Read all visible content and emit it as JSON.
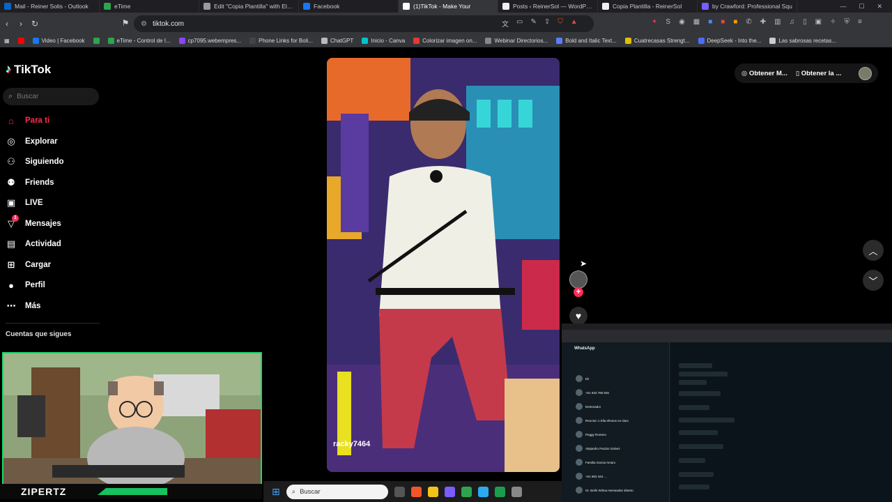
{
  "browser": {
    "tabs": [
      {
        "title": "Mail - Reiner Solis - Outlook",
        "color": "#0a64c8",
        "active": false
      },
      {
        "title": "eTime",
        "color": "#2ea44f",
        "active": false
      },
      {
        "title": "Edit \"Copia Plantilla\" with Elem",
        "color": "#9b9b9b",
        "active": false
      },
      {
        "title": "Facebook",
        "color": "#1877f2",
        "active": false
      },
      {
        "title": "(1)TikTok - Make Your",
        "color": "#ffffff",
        "active": true
      },
      {
        "title": "Posts ‹ ReinerSol — WordPress",
        "color": "#f0f0f0",
        "active": false
      },
      {
        "title": "Copia Plantilla - ReinerSol",
        "color": "#f0f0f0",
        "active": false
      },
      {
        "title": "by Crawford: Professional Squ",
        "color": "#7a5cff",
        "active": false
      }
    ],
    "url": "tiktok.com",
    "bookmarks": [
      {
        "label": "",
        "color": "#ff0000"
      },
      {
        "label": "Video | Facebook",
        "color": "#1877f2"
      },
      {
        "label": "",
        "color": "#2ea44f"
      },
      {
        "label": "eTime - Control de I...",
        "color": "#2ea44f"
      },
      {
        "label": "cp7095.webempres...",
        "color": "#8a44ff"
      },
      {
        "label": "Phone Links for Boli...",
        "color": "#444444"
      },
      {
        "label": "ChatGPT",
        "color": "#bbbbbb"
      },
      {
        "label": "Inicio - Canva",
        "color": "#00c4cc"
      },
      {
        "label": "Colorizar imagen on...",
        "color": "#e53935"
      },
      {
        "label": "Webinar Directorios...",
        "color": "#888888"
      },
      {
        "label": "Bold and Italic Text...",
        "color": "#5c7cfa"
      },
      {
        "label": "Cuatrecasas Strengt...",
        "color": "#e0c000"
      },
      {
        "label": "DeepSeek - Into the...",
        "color": "#4d6bfe"
      },
      {
        "label": "Las sabrosas recetas...",
        "color": "#cccccc"
      }
    ]
  },
  "tiktok": {
    "logo": "TikTok",
    "search_placeholder": "Buscar",
    "nav": [
      {
        "label": "Para ti",
        "icon": "home-icon",
        "glyph": "⌂",
        "active": true
      },
      {
        "label": "Explorar",
        "icon": "compass-icon",
        "glyph": "◎",
        "active": false
      },
      {
        "label": "Siguiendo",
        "icon": "following-icon",
        "glyph": "⚇",
        "active": false
      },
      {
        "label": "Friends",
        "icon": "friends-icon",
        "glyph": "⚉",
        "active": false
      },
      {
        "label": "LIVE",
        "icon": "live-icon",
        "glyph": "▣",
        "active": false
      },
      {
        "label": "Mensajes",
        "icon": "messages-icon",
        "glyph": "▽",
        "active": false,
        "badge": "1"
      },
      {
        "label": "Actividad",
        "icon": "activity-icon",
        "glyph": "▤",
        "active": false
      },
      {
        "label": "Cargar",
        "icon": "upload-icon",
        "glyph": "⊞",
        "active": false
      },
      {
        "label": "Perfil",
        "icon": "profile-icon",
        "glyph": "●",
        "active": false
      },
      {
        "label": "Más",
        "icon": "more-icon",
        "glyph": "⋯",
        "active": false
      }
    ],
    "following_title": "Cuentas que sigues",
    "video_username": "racky7464",
    "top_actions": [
      "Obtener M...",
      "Obtener la ..."
    ],
    "accent": "#fe2c55"
  },
  "webcam": {
    "name": "ZIPERTZ"
  },
  "whatsapp": {
    "title": "WhatsApp",
    "chats": [
      "Eli",
      "+51 933 786 846",
      "Entrenador",
      "Reunion 1 Ella efectos es claro",
      "Peggy Romero",
      "Alejandro Pardos Galvez",
      "Familia Garcia Amaro",
      "+51 953 163 ...",
      "Gr. Belle Wilma Hernandez Eberto"
    ]
  },
  "taskbar": {
    "search_label": "Buscar"
  }
}
